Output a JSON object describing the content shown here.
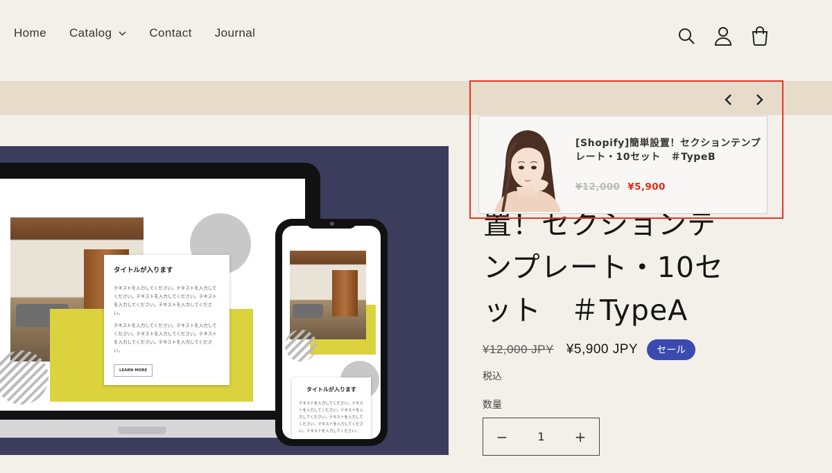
{
  "nav": {
    "items": [
      {
        "label": "Home"
      },
      {
        "label": "Catalog"
      },
      {
        "label": "Contact"
      },
      {
        "label": "Journal"
      }
    ]
  },
  "header_icons": [
    "search-icon",
    "account-icon",
    "cart-icon"
  ],
  "media": {
    "laptop_card": {
      "title": "タイトルが入ります",
      "text1": "テキストを入力してください。テキストを入力してください。テキストを入力してください。テキストを入力してください。テキストを入力してください。",
      "text2": "テキストを入力してください。テキストを入力してください。テキストを入力してください。テキストを入力してください。テキストを入力してください。",
      "button": "LEARN MORE"
    },
    "phone_card": {
      "title": "タイトルが入ります",
      "text": "テキストを入力してください。テキストを入力してください。テキストを入力してください。テキストを入力してください。テキストを入力してください。テキストを入力してください。"
    }
  },
  "product": {
    "title_line1": "置！セクションテ",
    "title_line2": "ンプレート・10セ",
    "title_line3": "ット　＃TypeA",
    "price_old": "¥12,000 JPY",
    "price_new": "¥5,900 JPY",
    "sale_badge": "セール",
    "tax": "税込",
    "quantity_label": "数量",
    "quantity_value": "1",
    "minus": "−",
    "plus": "+"
  },
  "popup": {
    "title": "[Shopify]簡単設置！セクションテンプレート・10セット　＃TypeB",
    "price_old": "¥12,000",
    "price_new": "¥5,900",
    "colors": {
      "frame": "#e8321f",
      "price_new": "#e02b16"
    }
  },
  "colors": {
    "background": "#f3f0e9",
    "announcement": "#e6dcc9",
    "sale_badge": "#3a4ab0"
  }
}
